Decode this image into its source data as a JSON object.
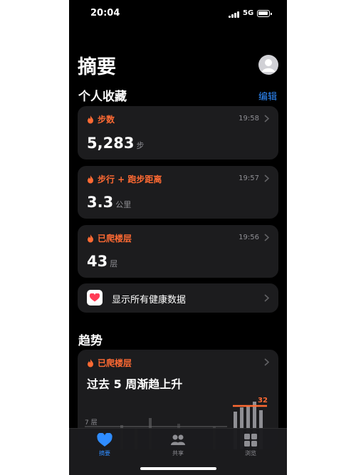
{
  "status_bar": {
    "time": "20:04",
    "network": "5G"
  },
  "header": {
    "title": "摘要"
  },
  "favorites": {
    "title": "个人收藏",
    "edit_label": "编辑",
    "cards": [
      {
        "label": "步数",
        "time": "19:58",
        "value": "5,283",
        "unit": "步"
      },
      {
        "label": "步行 + 跑步距离",
        "time": "19:57",
        "value": "3.3",
        "unit": "公里"
      },
      {
        "label": "已爬楼层",
        "time": "19:56",
        "value": "43",
        "unit": "层"
      }
    ],
    "show_all_label": "显示所有健康数据"
  },
  "trends": {
    "title": "趋势",
    "card": {
      "label": "已爬楼层",
      "description": "过去 5 周渐趋上升",
      "baseline_label": "7 层",
      "current_label": "32",
      "baseline_value": 7,
      "current_value": 32
    }
  },
  "tab_bar": {
    "tabs": [
      "摘要",
      "共享",
      "浏览"
    ]
  },
  "colors": {
    "accent": "#ff6a33",
    "link": "#2f8cff",
    "card_bg": "#1c1c1e"
  },
  "icons": [
    "flame-icon",
    "chevron-right-icon",
    "heart-icon",
    "share-people-icon",
    "grid-icon",
    "avatar-icon"
  ]
}
